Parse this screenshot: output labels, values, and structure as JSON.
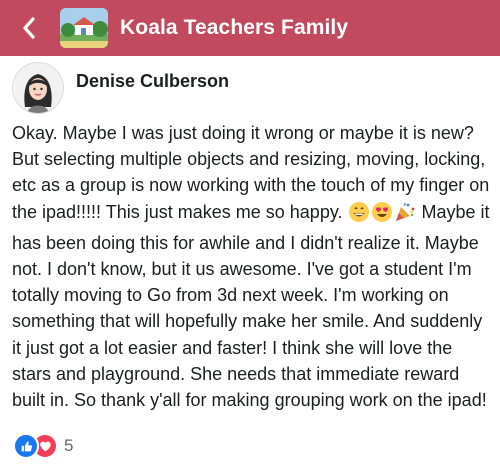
{
  "header": {
    "back_icon": "chevron-left-icon",
    "group_name": "Koala Teachers Family",
    "background_color": "#c14a5e"
  },
  "post": {
    "author_name": "Denise Culberson",
    "segments": {
      "text_1": "Okay. Maybe I was just doing it wrong or maybe it is new? But selecting multiple objects and resizing, moving, locking, etc as a group is now working with the touch of my finger on the ipad!!!!! This just makes me so happy.",
      "emojis": [
        "grinning-face-with-smiling-eyes",
        "smiling-face-with-heart-eyes",
        "party-popper"
      ],
      "text_2": "Maybe it has been doing this for awhile and I didn't realize it. Maybe not. I don't know, but it us awesome. I've got a student I'm totally moving to Go from 3d next week. I'm working on something that will hopefully make her smile. And suddenly it just got a lot easier and faster! I think she will love the stars and playground. She needs that immediate reward built in. So thank y'all for making grouping work on the ipad!"
    }
  },
  "reactions": {
    "types": [
      "like-icon",
      "love-icon"
    ],
    "count": "5",
    "like_color": "#1877f2",
    "love_color": "#f33e58"
  }
}
